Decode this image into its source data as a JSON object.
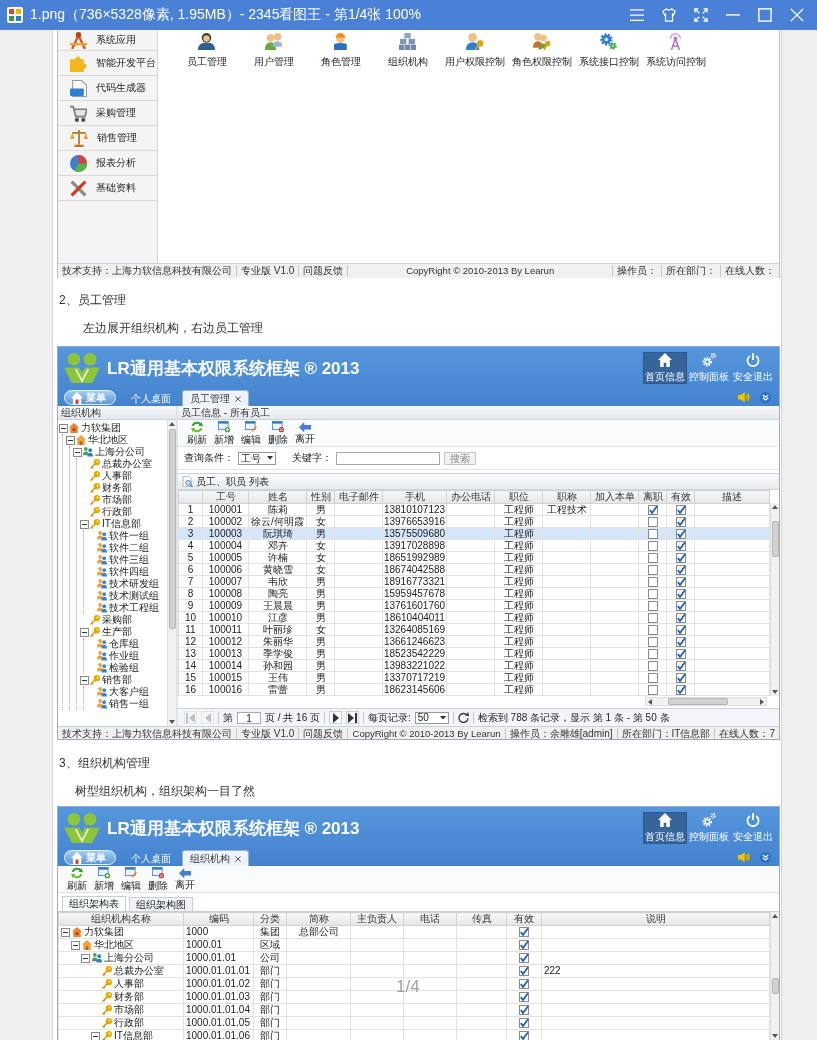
{
  "window": {
    "title": "1.png（736×5328像素, 1.95MB）- 2345看图王 - 第1/4张 100%",
    "page_indicator": "1/4"
  },
  "screenshot_1": {
    "sidebar": [
      {
        "label": "系统应用",
        "kind": "apps"
      },
      {
        "label": "智能开发平台",
        "kind": "puzzle"
      },
      {
        "label": "代码生成器",
        "kind": "code"
      },
      {
        "label": "采购管理",
        "kind": "cart"
      },
      {
        "label": "销售管理",
        "kind": "scale"
      },
      {
        "label": "报表分析",
        "kind": "pie"
      },
      {
        "label": "基础资料",
        "kind": "tools"
      }
    ],
    "shortcuts": [
      {
        "label": "员工管理",
        "kind": "person"
      },
      {
        "label": "用户管理",
        "kind": "users"
      },
      {
        "label": "角色管理",
        "kind": "worker"
      },
      {
        "label": "组织机构",
        "kind": "org"
      },
      {
        "label": "用户权限控制",
        "kind": "user_key"
      },
      {
        "label": "角色权限控制",
        "kind": "role_key"
      },
      {
        "label": "系统接口控制",
        "kind": "api"
      },
      {
        "label": "系统访问控制",
        "kind": "access"
      }
    ],
    "status_bar": {
      "support": "技术支持：上海力软信息科技有限公司",
      "edition": "专业版 V1.0",
      "feedback": "问题反馈",
      "copyright": "CopyRight © 2010-2013 By Learun",
      "operator": "操作员：",
      "department": "所在部门：",
      "online": "在线人数："
    }
  },
  "section_2": {
    "heading": "2、员工管理",
    "text": "左边展开组织机构，右边员工管理"
  },
  "screenshot_2": {
    "header": {
      "title": "LR通用基本权限系统框架 ® 2013",
      "nav": [
        {
          "label": "首页信息",
          "kind": "home",
          "selected": true
        },
        {
          "label": "控制面板",
          "kind": "settings",
          "selected": false
        },
        {
          "label": "安全退出",
          "kind": "logout",
          "selected": false
        }
      ],
      "menu_button": "菜单",
      "tabs": [
        {
          "label": "个人桌面",
          "selected": false,
          "closable": false
        },
        {
          "label": "员工管理",
          "selected": true,
          "closable": true
        }
      ]
    },
    "tree": {
      "title": "组织机构",
      "nodes": [
        {
          "label": "力软集团",
          "kind": "group",
          "expanded": true,
          "children": [
            {
              "label": "华北地区",
              "kind": "region",
              "expanded": true,
              "children": [
                {
                  "label": "上海分公司",
                  "kind": "company",
                  "expanded": true,
                  "children": [
                    {
                      "label": "总裁办公室",
                      "kind": "department"
                    },
                    {
                      "label": "人事部",
                      "kind": "department"
                    },
                    {
                      "label": "财务部",
                      "kind": "department"
                    },
                    {
                      "label": "市场部",
                      "kind": "department"
                    },
                    {
                      "label": "行政部",
                      "kind": "department"
                    },
                    {
                      "label": "IT信息部",
                      "kind": "department",
                      "expanded": true,
                      "children": [
                        {
                          "label": "软件一组",
                          "kind": "team"
                        },
                        {
                          "label": "软件二组",
                          "kind": "team"
                        },
                        {
                          "label": "软件三组",
                          "kind": "team"
                        },
                        {
                          "label": "软件四组",
                          "kind": "team"
                        },
                        {
                          "label": "技术研发组",
                          "kind": "team"
                        },
                        {
                          "label": "技术测试组",
                          "kind": "team"
                        },
                        {
                          "label": "技术工程组",
                          "kind": "team"
                        }
                      ]
                    },
                    {
                      "label": "采购部",
                      "kind": "department"
                    },
                    {
                      "label": "生产部",
                      "kind": "department",
                      "expanded": true,
                      "children": [
                        {
                          "label": "仓库组",
                          "kind": "team"
                        },
                        {
                          "label": "作业组",
                          "kind": "team"
                        },
                        {
                          "label": "检验组",
                          "kind": "team"
                        }
                      ]
                    },
                    {
                      "label": "销售部",
                      "kind": "department",
                      "expanded": true,
                      "children": [
                        {
                          "label": "大客户组",
                          "kind": "team"
                        },
                        {
                          "label": "销售一组",
                          "kind": "team"
                        }
                      ]
                    }
                  ]
                }
              ]
            }
          ]
        }
      ]
    },
    "panel_title": "员工信息 - 所有员工",
    "toolbar": [
      {
        "label": "刷新",
        "kind": "refresh"
      },
      {
        "label": "新增",
        "kind": "add"
      },
      {
        "label": "编辑",
        "kind": "edit"
      },
      {
        "label": "删除",
        "kind": "delete"
      },
      {
        "label": "离开",
        "kind": "exit"
      }
    ],
    "query": {
      "label": "查询条件：",
      "field": "工号",
      "keyword_label": "关键字：",
      "search_button": "搜索"
    },
    "grid_title": "员工、职员 列表",
    "table": {
      "columns": [
        "工号",
        "姓名",
        "性别",
        "电子邮件",
        "手机",
        "办公电话",
        "职位",
        "职称",
        "加入本单",
        "离职",
        "有效",
        "描述"
      ],
      "rows": [
        {
          "no": "1",
          "id": "100001",
          "name": "陈莉",
          "gender": "男",
          "mobile": "13810107123",
          "position": "工程师",
          "title": "工程技术",
          "resigned": true,
          "valid": true,
          "selected": false
        },
        {
          "no": "2",
          "id": "100002",
          "name": "徐云/何明霞",
          "gender": "女",
          "mobile": "13976653916",
          "position": "工程师",
          "resigned": false,
          "valid": true,
          "selected": false
        },
        {
          "no": "3",
          "id": "100003",
          "name": "阮琪琦",
          "gender": "男",
          "mobile": "13575509680",
          "position": "工程师",
          "resigned": false,
          "valid": true,
          "selected": true
        },
        {
          "no": "4",
          "id": "100004",
          "name": "邓卉",
          "gender": "女",
          "mobile": "13917028898",
          "position": "工程师",
          "resigned": false,
          "valid": true,
          "selected": false
        },
        {
          "no": "5",
          "id": "100005",
          "name": "许楠",
          "gender": "女",
          "mobile": "18651992989",
          "position": "工程师",
          "resigned": false,
          "valid": true,
          "selected": false
        },
        {
          "no": "6",
          "id": "100006",
          "name": "黄晓雪",
          "gender": "女",
          "mobile": "18674042588",
          "position": "工程师",
          "resigned": false,
          "valid": true,
          "selected": false
        },
        {
          "no": "7",
          "id": "100007",
          "name": "韦欣",
          "gender": "男",
          "mobile": "18916773321",
          "position": "工程师",
          "resigned": false,
          "valid": true,
          "selected": false
        },
        {
          "no": "8",
          "id": "100008",
          "name": "陶亮",
          "gender": "男",
          "mobile": "15959457678",
          "position": "工程师",
          "resigned": false,
          "valid": true,
          "selected": false
        },
        {
          "no": "9",
          "id": "100009",
          "name": "王晨晨",
          "gender": "男",
          "mobile": "13761601760",
          "position": "工程师",
          "resigned": false,
          "valid": true,
          "selected": false
        },
        {
          "no": "10",
          "id": "100010",
          "name": "江彦",
          "gender": "男",
          "mobile": "18610404011",
          "position": "工程师",
          "resigned": false,
          "valid": true,
          "selected": false
        },
        {
          "no": "11",
          "id": "100011",
          "name": "叶丽珍",
          "gender": "女",
          "mobile": "13264085169",
          "position": "工程师",
          "resigned": false,
          "valid": true,
          "selected": false
        },
        {
          "no": "12",
          "id": "100012",
          "name": "朱丽华",
          "gender": "男",
          "mobile": "13661246623",
          "position": "工程师",
          "resigned": false,
          "valid": true,
          "selected": false
        },
        {
          "no": "13",
          "id": "100013",
          "name": "季学俊",
          "gender": "男",
          "mobile": "18523542229",
          "position": "工程师",
          "resigned": false,
          "valid": true,
          "selected": false
        },
        {
          "no": "14",
          "id": "100014",
          "name": "孙和园",
          "gender": "男",
          "mobile": "13983221022",
          "position": "工程师",
          "resigned": false,
          "valid": true,
          "selected": false
        },
        {
          "no": "15",
          "id": "100015",
          "name": "王伟",
          "gender": "男",
          "mobile": "13370717219",
          "position": "工程师",
          "resigned": false,
          "valid": true,
          "selected": false
        },
        {
          "no": "16",
          "id": "100016",
          "name": "雷蕾",
          "gender": "男",
          "mobile": "18623145606",
          "position": "工程师",
          "resigned": false,
          "valid": true,
          "selected": false
        }
      ]
    },
    "pager": {
      "prev_buttons": [
        {
          "kind": "first",
          "disabled": true
        },
        {
          "kind": "prev",
          "disabled": true
        }
      ],
      "page_label": "第",
      "page": "1",
      "page_total": "页 / 共 16 页",
      "next_buttons": [
        {
          "kind": "next",
          "disabled": false
        },
        {
          "kind": "last",
          "disabled": false
        }
      ],
      "page_size_label": "每页记录:",
      "page_size": "50",
      "summary": "检索到 788 条记录，显示 第 1 条 - 第 50 条"
    },
    "status_bar": {
      "support": "技术支持：上海力软信息科技有限公司",
      "edition": "专业版 V1.0",
      "feedback": "问题反馈",
      "copyright": "CopyRight © 2010-2013 By Learun",
      "operator": "操作员：余雕雄[admin]",
      "department": "所在部门：IT信息部",
      "online": "在线人数：7"
    }
  },
  "section_3": {
    "heading": "3、组织机构管理",
    "text": "树型组织机构，组织架构一目了然"
  },
  "screenshot_3": {
    "header": {
      "title": "LR通用基本权限系统框架 ® 2013",
      "nav": [
        {
          "label": "首页信息",
          "kind": "home",
          "selected": true
        },
        {
          "label": "控制面板",
          "kind": "settings",
          "selected": false
        },
        {
          "label": "安全退出",
          "kind": "logout",
          "selected": false
        }
      ],
      "menu_button": "菜单",
      "tabs": [
        {
          "label": "个人桌面",
          "selected": false,
          "closable": false
        },
        {
          "label": "组织机构",
          "selected": true,
          "closable": true
        }
      ]
    },
    "toolbar": [
      {
        "label": "刷新",
        "kind": "refresh"
      },
      {
        "label": "新增",
        "kind": "add"
      },
      {
        "label": "编辑",
        "kind": "edit"
      },
      {
        "label": "删除",
        "kind": "delete"
      },
      {
        "label": "离开",
        "kind": "exit"
      }
    ],
    "subtabs": [
      {
        "label": "组织架构表",
        "selected": true
      },
      {
        "label": "组织架构图",
        "selected": false
      }
    ],
    "table": {
      "columns": [
        "组织机构名称",
        "编码",
        "分类",
        "简称",
        "主负责人",
        "电话",
        "传真",
        "有效",
        "说明"
      ],
      "rows": [
        {
          "name": "力软集团",
          "kind": "group",
          "expanded": true,
          "code": "1000",
          "category": "集团",
          "short_name": "总部公司",
          "valid": true,
          "children": [
            {
              "name": "华北地区",
              "kind": "region",
              "expanded": true,
              "code": "1000.01",
              "category": "区域",
              "valid": true,
              "children": [
                {
                  "name": "上海分公司",
                  "kind": "company",
                  "expanded": true,
                  "code": "1000.01.01",
                  "category": "公司",
                  "valid": true,
                  "children": [
                    {
                      "name": "总裁办公室",
                      "kind": "department",
                      "code": "1000.01.01.01",
                      "category": "部门",
                      "valid": true,
                      "note": "222"
                    },
                    {
                      "name": "人事部",
                      "kind": "department",
                      "code": "1000.01.01.02",
                      "category": "部门",
                      "valid": true
                    },
                    {
                      "name": "财务部",
                      "kind": "department",
                      "code": "1000.01.01.03",
                      "category": "部门",
                      "valid": true
                    },
                    {
                      "name": "市场部",
                      "kind": "department",
                      "code": "1000.01.01.04",
                      "category": "部门",
                      "valid": true
                    },
                    {
                      "name": "行政部",
                      "kind": "department",
                      "code": "1000.01.01.05",
                      "category": "部门",
                      "valid": true
                    },
                    {
                      "name": "IT信息部",
                      "kind": "department",
                      "expanded": true,
                      "code": "1000.01.01.06",
                      "category": "部门",
                      "valid": true
                    }
                  ]
                }
              ]
            }
          ]
        }
      ]
    }
  }
}
